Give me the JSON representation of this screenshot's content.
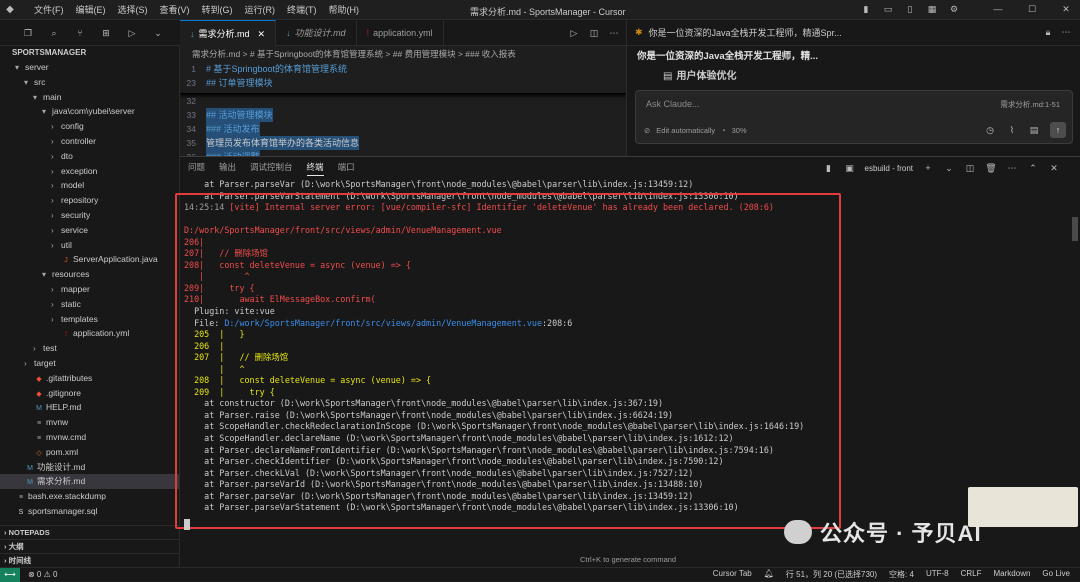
{
  "menu": [
    "文件(F)",
    "编辑(E)",
    "选择(S)",
    "查看(V)",
    "转到(G)",
    "运行(R)",
    "终端(T)",
    "帮助(H)"
  ],
  "window_title": "需求分析.md - SportsManager - Cursor",
  "explorer": {
    "root": "SPORTSMANAGER",
    "items": [
      {
        "indent": 1,
        "chev": "▾",
        "label": "server",
        "type": "folder"
      },
      {
        "indent": 2,
        "chev": "▾",
        "label": "src",
        "type": "folder"
      },
      {
        "indent": 3,
        "chev": "▾",
        "label": "main",
        "type": "folder"
      },
      {
        "indent": 4,
        "chev": "▾",
        "label": "java\\com\\yubei\\server",
        "type": "folder"
      },
      {
        "indent": 5,
        "chev": "›",
        "label": "config",
        "type": "folder"
      },
      {
        "indent": 5,
        "chev": "›",
        "label": "controller",
        "type": "folder"
      },
      {
        "indent": 5,
        "chev": "›",
        "label": "dto",
        "type": "folder"
      },
      {
        "indent": 5,
        "chev": "›",
        "label": "exception",
        "type": "folder"
      },
      {
        "indent": 5,
        "chev": "›",
        "label": "model",
        "type": "folder"
      },
      {
        "indent": 5,
        "chev": "›",
        "label": "repository",
        "type": "folder"
      },
      {
        "indent": 5,
        "chev": "›",
        "label": "security",
        "type": "folder"
      },
      {
        "indent": 5,
        "chev": "›",
        "label": "service",
        "type": "folder"
      },
      {
        "indent": 5,
        "chev": "›",
        "label": "util",
        "type": "folder"
      },
      {
        "indent": 5,
        "chev": "",
        "label": "ServerApplication.java",
        "type": "java"
      },
      {
        "indent": 4,
        "chev": "▾",
        "label": "resources",
        "type": "folder"
      },
      {
        "indent": 5,
        "chev": "›",
        "label": "mapper",
        "type": "folder"
      },
      {
        "indent": 5,
        "chev": "›",
        "label": "static",
        "type": "folder"
      },
      {
        "indent": 5,
        "chev": "›",
        "label": "templates",
        "type": "folder"
      },
      {
        "indent": 5,
        "chev": "",
        "label": "application.yml",
        "type": "yml"
      },
      {
        "indent": 3,
        "chev": "›",
        "label": "test",
        "type": "folder"
      },
      {
        "indent": 2,
        "chev": "›",
        "label": "target",
        "type": "folder"
      },
      {
        "indent": 2,
        "chev": "",
        "label": ".gitattributes",
        "type": "git"
      },
      {
        "indent": 2,
        "chev": "",
        "label": ".gitignore",
        "type": "git"
      },
      {
        "indent": 2,
        "chev": "",
        "label": "HELP.md",
        "type": "md"
      },
      {
        "indent": 2,
        "chev": "",
        "label": "mvnw",
        "type": "file"
      },
      {
        "indent": 2,
        "chev": "",
        "label": "mvnw.cmd",
        "type": "file"
      },
      {
        "indent": 2,
        "chev": "",
        "label": "pom.xml",
        "type": "xml"
      },
      {
        "indent": 1,
        "chev": "",
        "label": "功能设计.md",
        "type": "md"
      },
      {
        "indent": 1,
        "chev": "",
        "label": "需求分析.md",
        "type": "md",
        "selected": true
      },
      {
        "indent": 0,
        "chev": "",
        "label": "bash.exe.stackdump",
        "type": "file"
      },
      {
        "indent": 0,
        "chev": "",
        "label": "sportsmanager.sql",
        "type": "sql"
      }
    ],
    "sections": [
      "NOTEPADS",
      "大纲",
      "时间线"
    ]
  },
  "tabs": [
    {
      "label": "需求分析.md",
      "active": true
    },
    {
      "label": "功能设计.md",
      "active": false
    },
    {
      "label": "application.yml",
      "active": false
    }
  ],
  "breadcrumb": "需求分析.md > # 基于Springboot的体育馆管理系统 > ## 费用管理模块 > ### 收入报表",
  "editor": {
    "sticky": [
      {
        "ln": "1",
        "text": "# 基于Springboot的体育馆管理系统"
      },
      {
        "ln": "23",
        "text": "## 订单管理模块"
      }
    ],
    "lines": [
      {
        "ln": "32",
        "text": "",
        "hl": false
      },
      {
        "ln": "33",
        "text": "## 活动管理模块",
        "hl": true
      },
      {
        "ln": "34",
        "text": "### 活动发布",
        "hl": true
      },
      {
        "ln": "35",
        "text": "管理员发布体育馆举办的各类活动信息",
        "hl": true,
        "plain": true
      },
      {
        "ln": "36",
        "text": "### 活动调整",
        "hl": true
      }
    ]
  },
  "chat": {
    "tab_title": "你是一位资深的Java全栈开发工程师，精通Spr...",
    "header": "你是一位资深的Java全栈开发工程师，精...",
    "section": "用户体验优化",
    "input_placeholder": "Ask Claude...",
    "context": "需求分析.md:1-51",
    "edit_auto": "Edit automatically",
    "percent": "30%"
  },
  "panel": {
    "tabs": [
      "问题",
      "输出",
      "调试控制台",
      "终端",
      "端口"
    ],
    "active_tab": "终端",
    "terminal_name": "esbuild - front",
    "hint": "Ctrl+K to generate command"
  },
  "terminal": [
    {
      "c": "n",
      "t": "    at Parser.parseVar (D:\\work\\SportsManager\\front\\node_modules\\@babel\\parser\\lib\\index.js:13459:12)"
    },
    {
      "c": "n",
      "t": "    at Parser.parseVarStatement (D:\\work\\SportsManager\\front\\node_modules\\@babel\\parser\\lib\\index.js:13306:10)"
    },
    {
      "c": "err",
      "t": "14:25:14 [vite] Internal server error: [vue/compiler-sfc] Identifier 'deleteVenue' has already been declared. (208:6)"
    },
    {
      "c": "n",
      "t": ""
    },
    {
      "c": "red",
      "t": "D:/work/SportsManager/front/src/views/admin/VenueManagement.vue"
    },
    {
      "c": "red",
      "t": "206|"
    },
    {
      "c": "red",
      "t": "207|   // 删除场馆"
    },
    {
      "c": "red",
      "t": "208|   const deleteVenue = async (venue) => {"
    },
    {
      "c": "red",
      "t": "   |        ^"
    },
    {
      "c": "red",
      "t": "209|     try {"
    },
    {
      "c": "red",
      "t": "210|       await ElMessageBox.confirm("
    },
    {
      "c": "n",
      "t": "  Plugin: vite:vue"
    },
    {
      "c": "file",
      "t": "  File: D:/work/SportsManager/front/src/views/admin/VenueManagement.vue:208:6"
    },
    {
      "c": "yellow",
      "t": "  205  |   }"
    },
    {
      "c": "yellow",
      "t": "  206  |"
    },
    {
      "c": "yellow",
      "t": "  207  |   // 删除场馆"
    },
    {
      "c": "yellow",
      "t": "       |   ^"
    },
    {
      "c": "yellow",
      "t": "  208  |   const deleteVenue = async (venue) => {"
    },
    {
      "c": "yellow",
      "t": "  209  |     try {"
    },
    {
      "c": "n",
      "t": "    at constructor (D:\\work\\SportsManager\\front\\node_modules\\@babel\\parser\\lib\\index.js:367:19)"
    },
    {
      "c": "n",
      "t": "    at Parser.raise (D:\\work\\SportsManager\\front\\node_modules\\@babel\\parser\\lib\\index.js:6624:19)"
    },
    {
      "c": "n",
      "t": "    at ScopeHandler.checkRedeclarationInScope (D:\\work\\SportsManager\\front\\node_modules\\@babel\\parser\\lib\\index.js:1646:19)"
    },
    {
      "c": "n",
      "t": "    at ScopeHandler.declareName (D:\\work\\SportsManager\\front\\node_modules\\@babel\\parser\\lib\\index.js:1612:12)"
    },
    {
      "c": "n",
      "t": "    at Parser.declareNameFromIdentifier (D:\\work\\SportsManager\\front\\node_modules\\@babel\\parser\\lib\\index.js:7594:16)"
    },
    {
      "c": "n",
      "t": "    at Parser.checkIdentifier (D:\\work\\SportsManager\\front\\node_modules\\@babel\\parser\\lib\\index.js:7590:12)"
    },
    {
      "c": "n",
      "t": "    at Parser.checkLVal (D:\\work\\SportsManager\\front\\node_modules\\@babel\\parser\\lib\\index.js:7527:12)"
    },
    {
      "c": "n",
      "t": "    at Parser.parseVarId (D:\\work\\SportsManager\\front\\node_modules\\@babel\\parser\\lib\\index.js:13488:10)"
    },
    {
      "c": "n",
      "t": "    at Parser.parseVar (D:\\work\\SportsManager\\front\\node_modules\\@babel\\parser\\lib\\index.js:13459:12)"
    },
    {
      "c": "n",
      "t": "    at Parser.parseVarStatement (D:\\work\\SportsManager\\front\\node_modules\\@babel\\parser\\lib\\index.js:13306:10)"
    }
  ],
  "statusbar": {
    "problems": "⊗ 0  ⚠ 0",
    "cursor_tab": "Cursor Tab",
    "position": "行 51，列 20 (已选择730)",
    "spaces": "空格: 4",
    "encoding": "UTF-8",
    "eol": "CRLF",
    "language": "Markdown",
    "golive": "Go Live"
  },
  "watermark": "公众号 · 予贝AI",
  "colors": {
    "accent": "#0078d4",
    "error_box": "#e03c3c",
    "terminal_red": "#f14c4c",
    "terminal_yellow": "#e5e510"
  }
}
